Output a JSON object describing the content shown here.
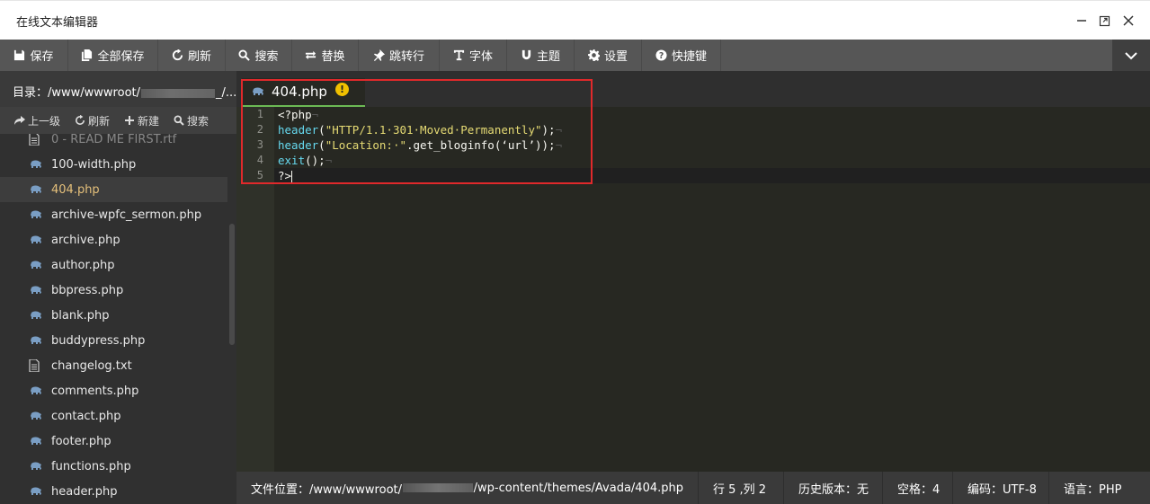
{
  "window": {
    "title": "在线文本编辑器"
  },
  "toolbar": {
    "items": [
      {
        "label": "保存",
        "icon": "floppy-icon"
      },
      {
        "label": "全部保存",
        "icon": "copy-icon"
      },
      {
        "label": "刷新",
        "icon": "refresh-icon"
      },
      {
        "label": "搜索",
        "icon": "search-icon"
      },
      {
        "label": "替换",
        "icon": "replace-icon"
      },
      {
        "label": "跳转行",
        "icon": "pin-icon"
      },
      {
        "label": "字体",
        "icon": "text-icon"
      },
      {
        "label": "主题",
        "icon": "magnet-icon"
      },
      {
        "label": "设置",
        "icon": "gear-icon"
      },
      {
        "label": "快捷键",
        "icon": "question-icon"
      }
    ]
  },
  "sidebar": {
    "dir_prefix": "目录：/www/wwwroot/",
    "dir_suffix": "_/...",
    "actions": [
      {
        "label": "上一级",
        "icon": "share-icon"
      },
      {
        "label": "刷新",
        "icon": "refresh-icon"
      },
      {
        "label": "新建",
        "icon": "plus-icon"
      },
      {
        "label": "搜索",
        "icon": "search-icon"
      }
    ],
    "files": [
      {
        "name": "0 - READ ME FIRST.rtf",
        "type": "text"
      },
      {
        "name": "100-width.php",
        "type": "php"
      },
      {
        "name": "404.php",
        "type": "php"
      },
      {
        "name": "archive-wpfc_sermon.php",
        "type": "php"
      },
      {
        "name": "archive.php",
        "type": "php"
      },
      {
        "name": "author.php",
        "type": "php"
      },
      {
        "name": "bbpress.php",
        "type": "php"
      },
      {
        "name": "blank.php",
        "type": "php"
      },
      {
        "name": "buddypress.php",
        "type": "php"
      },
      {
        "name": "changelog.txt",
        "type": "text"
      },
      {
        "name": "comments.php",
        "type": "php"
      },
      {
        "name": "contact.php",
        "type": "php"
      },
      {
        "name": "footer.php",
        "type": "php"
      },
      {
        "name": "functions.php",
        "type": "php"
      },
      {
        "name": "header.php",
        "type": "php"
      }
    ],
    "active_file": "404.php"
  },
  "editor": {
    "tab_label": "404.php",
    "tab_warning": "!",
    "line_numbers": [
      "1",
      "2",
      "3",
      "4",
      "5"
    ],
    "lines": [
      {
        "parts": [
          {
            "t": "<?php",
            "c": ""
          },
          {
            "t": "¬",
            "c": "inv"
          }
        ]
      },
      {
        "parts": [
          {
            "t": "header",
            "c": "kw"
          },
          {
            "t": "(",
            "c": ""
          },
          {
            "t": "\"HTTP/1.1·301·Moved·Permanently\"",
            "c": "str"
          },
          {
            "t": ");",
            "c": ""
          },
          {
            "t": "¬",
            "c": "inv"
          }
        ]
      },
      {
        "parts": [
          {
            "t": "header",
            "c": "kw"
          },
          {
            "t": "(",
            "c": ""
          },
          {
            "t": "\"Location:·\"",
            "c": "str"
          },
          {
            "t": ".get_bloginfo(‘url’));",
            "c": ""
          },
          {
            "t": "¬",
            "c": "inv"
          }
        ]
      },
      {
        "parts": [
          {
            "t": "exit",
            "c": "kw"
          },
          {
            "t": "();",
            "c": ""
          },
          {
            "t": "¬",
            "c": "inv"
          }
        ]
      },
      {
        "parts": [
          {
            "t": "?>",
            "c": ""
          }
        ]
      }
    ]
  },
  "statusbar": {
    "path_prefix": "文件位置：/www/wwwroot/",
    "path_suffix": "/wp-content/themes/Avada/404.php",
    "position": "行 5 ,列 2",
    "history": "历史版本：无",
    "indent": "空格：4",
    "encoding": "编码：UTF-8",
    "language": "语言：PHP"
  },
  "colors": {
    "toolbar_bg": "#565656",
    "editor_bg": "#272822",
    "tab_underline": "#6cba54",
    "highlight_box": "#e0292b",
    "active_file_text": "#e5c07b"
  }
}
